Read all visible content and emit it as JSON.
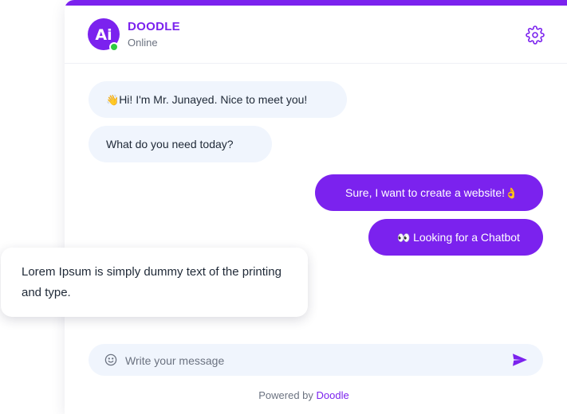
{
  "header": {
    "bot_name": "DOODLE",
    "status": "Online",
    "avatar_text": "Ai"
  },
  "messages": [
    {
      "direction": "incoming",
      "emoji": "👋",
      "text": "Hi! I'm Mr. Junayed. Nice to meet you!"
    },
    {
      "direction": "incoming",
      "emoji": "",
      "text": "What do you need today?"
    },
    {
      "direction": "outgoing",
      "emoji": "👌",
      "text": "Sure, I want to create a website!"
    },
    {
      "direction": "outgoing",
      "emoji": "👀",
      "text": "Looking for a Chatbot"
    }
  ],
  "overlay_card": {
    "text": "Lorem Ipsum is simply dummy text of the printing and type."
  },
  "composer": {
    "placeholder": "Write your message",
    "value": ""
  },
  "footer": {
    "powered_prefix": "Powered by",
    "powered_brand": "Doodle"
  },
  "icons": {
    "settings": "gear-icon",
    "emoji": "smile-icon",
    "send": "send-icon"
  },
  "colors": {
    "accent": "#7b22ee",
    "incoming_bubble": "#f0f5fd",
    "online": "#2ecc40"
  }
}
